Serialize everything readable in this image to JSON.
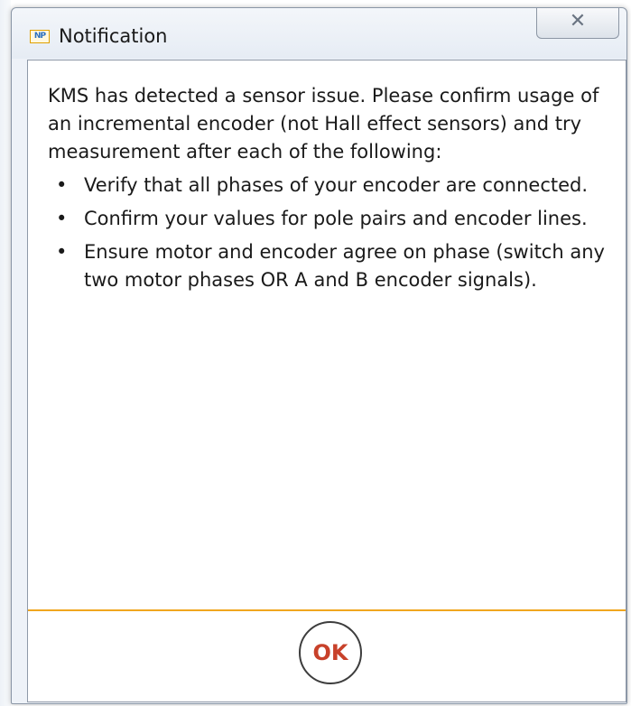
{
  "window": {
    "title": "Notification",
    "app_icon_text": "NP",
    "close_label": "✕"
  },
  "message": {
    "intro": "KMS has detected a sensor issue. Please confirm usage of an incremental encoder (not Hall effect sensors) and try measurement after each of the following:",
    "bullet_char": "•",
    "items": [
      "Verify that all phases of your encoder are connected.",
      "Confirm your values for pole pairs and encoder lines.",
      "Ensure motor and encoder agree on phase (switch any two motor phases OR A and B encoder signals)."
    ]
  },
  "footer": {
    "ok_label": "OK"
  },
  "colors": {
    "divider": "#f0a61e",
    "ok_text": "#c8412a"
  }
}
